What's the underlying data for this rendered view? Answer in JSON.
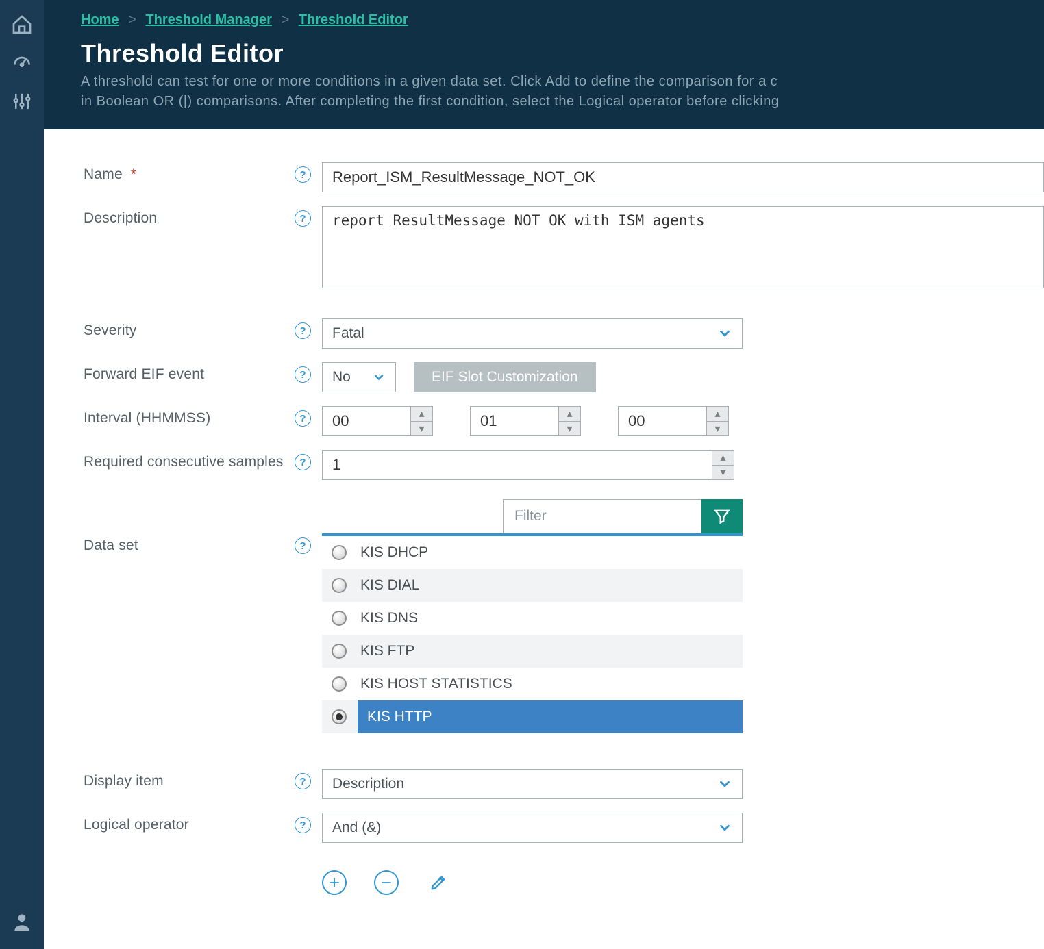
{
  "breadcrumb": {
    "home": "Home",
    "mgr": "Threshold Manager",
    "editor": "Threshold Editor"
  },
  "page": {
    "title": "Threshold Editor",
    "desc_l1": "A threshold can test for one or more conditions in a given data set. Click Add to define the comparison for a c",
    "desc_l2": "in Boolean OR (|) comparisons. After completing the first condition, select the Logical operator before clicking"
  },
  "form": {
    "name_label": "Name",
    "name_value": "Report_ISM_ResultMessage_NOT_OK",
    "desc_label": "Description",
    "desc_value": "report ResultMessage NOT OK with ISM agents",
    "severity_label": "Severity",
    "severity_value": "Fatal",
    "eif_label": "Forward EIF event",
    "eif_value": "No",
    "eif_button": "EIF Slot Customization",
    "interval_label": "Interval (HHMMSS)",
    "interval_hh": "00",
    "interval_mm": "01",
    "interval_ss": "00",
    "samples_label": "Required consecutive samples",
    "samples_value": "1",
    "filter_placeholder": "Filter",
    "dataset_label": "Data set",
    "dataset_items": [
      {
        "label": "KIS DHCP",
        "selected": false
      },
      {
        "label": "KIS DIAL",
        "selected": false
      },
      {
        "label": "KIS DNS",
        "selected": false
      },
      {
        "label": "KIS FTP",
        "selected": false
      },
      {
        "label": "KIS HOST STATISTICS",
        "selected": false
      },
      {
        "label": "KIS HTTP",
        "selected": true
      }
    ],
    "display_label": "Display item",
    "display_value": "Description",
    "logic_label": "Logical operator",
    "logic_value": "And (&)"
  }
}
